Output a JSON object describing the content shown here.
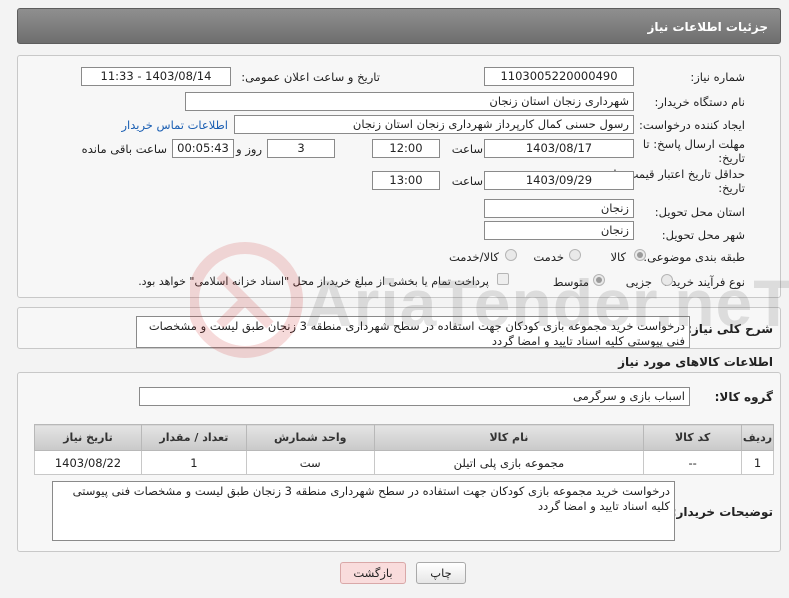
{
  "header": {
    "title": "جزئیات اطلاعات نیاز"
  },
  "form": {
    "need_number_label": "شماره نیاز:",
    "need_number": "1103005220000490",
    "announce_label": "تاریخ و ساعت اعلان عمومی:",
    "announce_value": "1403/08/14 - 11:33",
    "buyer_org_label": "نام دستگاه خریدار:",
    "buyer_org": "شهرداری زنجان استان زنجان",
    "creator_label": "ایجاد کننده درخواست:",
    "creator": "رسول حسنی کمال کارپرداز شهرداری زنجان استان زنجان",
    "contact_link": "اطلاعات تماس خریدار",
    "reply_deadline_label_1": "مهلت ارسال پاسخ: تا",
    "reply_deadline_label_2": "تاریخ:",
    "reply_date": "1403/08/17",
    "time_label": "ساعت",
    "reply_time": "12:00",
    "days_value": "3",
    "days_label": "روز و",
    "remaining_value": "00:05:43",
    "remaining_label": "ساعت باقی مانده",
    "validity_label_1": "حداقل تاریخ اعتبار قیمت: تا",
    "validity_label_2": "تاریخ:",
    "validity_date": "1403/09/29",
    "validity_time": "13:00",
    "province_label": "استان محل تحویل:",
    "province": "زنجان",
    "city_label": "شهر محل تحویل:",
    "city": "زنجان",
    "category_label": "طبقه بندی موضوعی:",
    "category_options": [
      "کالا",
      "خدمت",
      "کالا/خدمت"
    ],
    "process_label": "نوع فرآیند خرید :",
    "process_options": [
      "جزیی",
      "متوسط"
    ],
    "treasury_note": "پرداخت تمام یا بخشی از مبلغ خرید،از محل \"اسناد خزانه اسلامی\" خواهد بود."
  },
  "description": {
    "label": "شرح کلی نیاز:",
    "text": "درخواست خرید مجموعه بازی کودکان  جهت استفاده در سطح شهرداری منطقه 3 زنجان طبق لیست و مشخصات فنی پیوستی کلیه اسناد تایید و امضا گردد"
  },
  "goods": {
    "section_title": "اطلاعات کالاهای مورد نیاز",
    "group_label": "گروه کالا:",
    "group_value": "اسباب بازی و سرگرمی",
    "columns": [
      "ردیف",
      "کد کالا",
      "نام کالا",
      "واحد شمارش",
      "تعداد / مقدار",
      "تاریخ نیاز"
    ],
    "rows": [
      [
        "1",
        "--",
        "مجموعه بازی پلی اتیلن",
        "ست",
        "1",
        "1403/08/22"
      ]
    ]
  },
  "buyer_notes": {
    "label": "توضیحات خریدار:",
    "text": "درخواست خرید مجموعه بازی کودکان  جهت استفاده در سطح شهرداری منطقه 3 زنجان طبق لیست و مشخصات فنی پیوستی کلیه اسناد تایید و امضا گردد"
  },
  "buttons": {
    "print": "چاپ",
    "back": "بازگشت"
  },
  "watermark": {
    "text": "AriaTender.neT"
  },
  "colors": {
    "title_bar": "#7a7a7a",
    "link": "#1b5fb3",
    "back_button_bg": "#f9dcdc"
  }
}
